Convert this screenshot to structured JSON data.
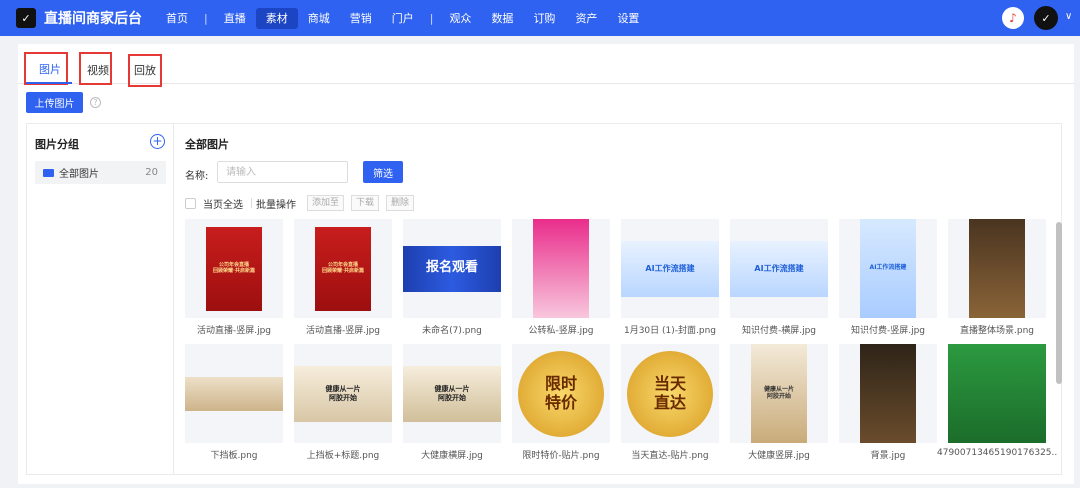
{
  "topbar": {
    "brand": "直播间商家后台",
    "logo_icon": "logo-icon",
    "nav": [
      "首页",
      "直播",
      "素材",
      "商城",
      "营销",
      "门户",
      "观众",
      "数据",
      "订购",
      "资产",
      "设置"
    ],
    "active": "素材",
    "bell_icon": "bell-icon",
    "caret": "∨"
  },
  "tabs": {
    "image": "图片",
    "video": "视频",
    "replay": "回放"
  },
  "toolbar": {
    "upload": "上传图片",
    "help": "?"
  },
  "sidebar": {
    "title": "图片分组",
    "plus": "+",
    "group": {
      "name": "全部图片",
      "count": "20"
    }
  },
  "main": {
    "title": "全部图片",
    "name_label": "名称:",
    "name_placeholder": "请输入",
    "filter": "筛选",
    "select_all": "当页全选",
    "batch": "批量操作",
    "add_to": "添加至",
    "download": "下载",
    "delete": "删除"
  },
  "images": [
    {
      "caption": "活动直播-竖屏.jpg"
    },
    {
      "caption": "活动直播-竖屏.jpg"
    },
    {
      "caption": "未命名(7).png"
    },
    {
      "caption": "公转私-竖屏.jpg"
    },
    {
      "caption": "1月30日 (1)-封面.png"
    },
    {
      "caption": "知识付费-横屏.jpg"
    },
    {
      "caption": "知识付费-竖屏.jpg"
    },
    {
      "caption": "直播整体场景.png"
    },
    {
      "caption": "下挡板.png"
    },
    {
      "caption": "上挡板+标题.png"
    },
    {
      "caption": "大健康横屏.jpg"
    },
    {
      "caption": "限时特价-贴片.png"
    },
    {
      "caption": "当天直达-贴片.png"
    },
    {
      "caption": "大健康竖屏.jpg"
    },
    {
      "caption": "背景.jpg"
    },
    {
      "caption": "47900713465190176325..."
    }
  ],
  "art_text": {
    "red1": "公司年会直播\n回顾荣耀·共启新篇",
    "live": "报名观看",
    "ai": "AI工作流搭建",
    "health": "健康从一片\n阿胶开始",
    "limit": "限时\n特价",
    "today": "当天\n直达"
  }
}
